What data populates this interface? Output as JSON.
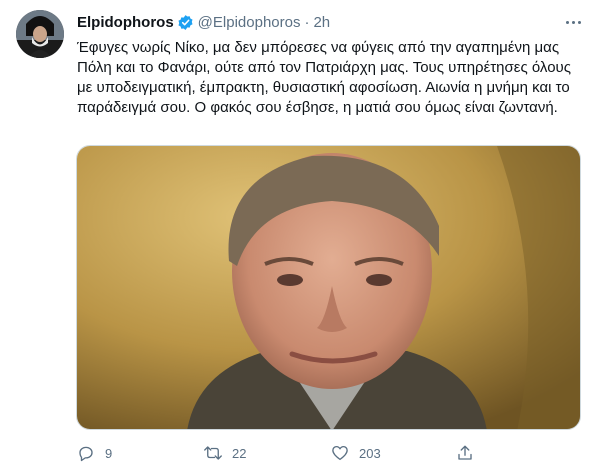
{
  "tweet": {
    "author_name": "Elpidophoros",
    "handle": "@Elpidophoros",
    "separator": "·",
    "time": "2h",
    "text": "Έφυγες νωρίς Νίκο, μα δεν μπόρεσες να φύγεις από την αγαπημένη μας Πόλη και το Φανάρι, ούτε από τον Πατριάρχη μας. Τους υπηρέτησες όλους με υποδειγματική, έμπρακτη, θυσιαστική αφοσίωση. Αιωνία η μνήμη και το παράδειγμά σου. Ο φακός σου έσβησε, η ματιά σου όμως είναι ζωντανή."
  },
  "actions": {
    "reply_count": "9",
    "retweet_count": "22",
    "like_count": "203"
  },
  "colors": {
    "text": "#0f1419",
    "secondary": "#5b7083",
    "verified": "#1da1f2",
    "border": "#cfd9de"
  },
  "icons": {
    "verified": "verified-badge-icon",
    "more": "more-options-icon",
    "reply": "reply-icon",
    "retweet": "retweet-icon",
    "like": "heart-icon",
    "share": "share-icon"
  }
}
